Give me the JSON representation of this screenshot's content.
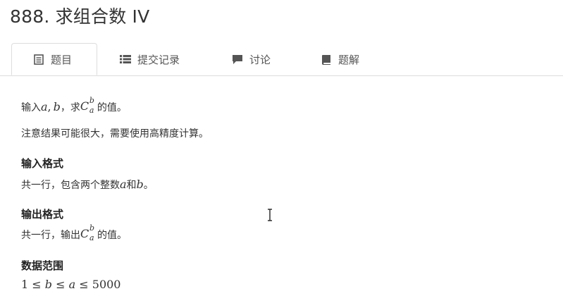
{
  "problem": {
    "title": "888. 求组合数 IV"
  },
  "tabs": [
    {
      "label": "题目",
      "icon": "document-icon",
      "active": true
    },
    {
      "label": "提交记录",
      "icon": "list-icon",
      "active": false
    },
    {
      "label": "讨论",
      "icon": "comment-icon",
      "active": false
    },
    {
      "label": "题解",
      "icon": "book-icon",
      "active": false
    }
  ],
  "description": {
    "line1_prefix": "输入",
    "line1_var_a": "a",
    "line1_comma": ",",
    "line1_var_b": "b",
    "line1_mid": "，求",
    "line1_C": "C",
    "line1_sup": "b",
    "line1_sub": "a",
    "line1_suffix": "的值。",
    "line2": "注意结果可能很大，需要使用高精度计算。"
  },
  "input_format": {
    "heading": "输入格式",
    "text_prefix": "共一行，包含两个整数",
    "var_a": "a",
    "text_mid": "和",
    "var_b": "b",
    "text_suffix": "。"
  },
  "output_format": {
    "heading": "输出格式",
    "text_prefix": "共一行，输出",
    "C": "C",
    "sup": "b",
    "sub": "a",
    "text_suffix": "的值。"
  },
  "data_range": {
    "heading": "数据范围",
    "one": "1",
    "le1": "≤",
    "b": "b",
    "le2": "≤",
    "a": "a",
    "le3": "≤",
    "max": "5000"
  },
  "colors": {
    "text": "#333333",
    "border": "#dddddd",
    "icon": "#555555"
  }
}
